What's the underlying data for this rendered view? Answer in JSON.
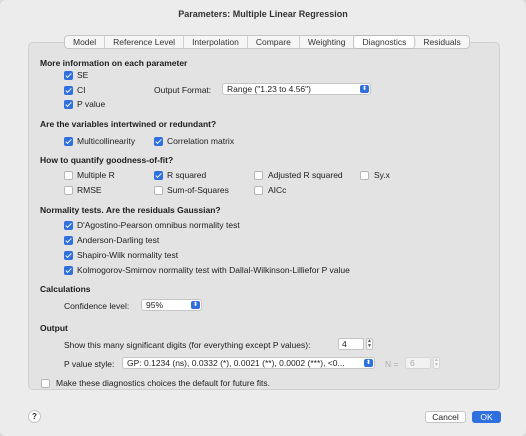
{
  "window": {
    "title": "Parameters: Multiple Linear Regression"
  },
  "tabs": [
    "Model",
    "Reference Level",
    "Interpolation",
    "Compare",
    "Weighting",
    "Diagnostics",
    "Residuals"
  ],
  "active_tab": "Diagnostics",
  "sections": {
    "more_info": {
      "header": "More information on each parameter",
      "se": "SE",
      "ci": "CI",
      "p_value": "P value",
      "output_format_label": "Output Format:",
      "output_format_value": "Range (\"1.23 to 4.56\")"
    },
    "redundant": {
      "header": "Are the variables intertwined or redundant?",
      "multicollinearity": "Multicollinearity",
      "correlation_matrix": "Correlation matrix"
    },
    "goodness": {
      "header": "How to quantify goodness-of-fit?",
      "multiple_r": "Multiple R",
      "r_squared": "R squared",
      "adj_r_squared": "Adjusted R squared",
      "syx": "Sy.x",
      "rmse": "RMSE",
      "sum_of_squares": "Sum-of-Squares",
      "aicc": "AICc"
    },
    "normality": {
      "header": "Normality tests. Are the residuals Gaussian?",
      "dagostino": "D'Agostino-Pearson omnibus normality test",
      "anderson": "Anderson-Darling test",
      "shapiro": "Shapiro-Wilk normality test",
      "kolmogorov": "Kolmogorov-Smirnov normality test with Dallal-Wilkinson-Lilliefor P value"
    },
    "calculations": {
      "header": "Calculations",
      "confidence_label": "Confidence level:",
      "confidence_value": "95%"
    },
    "output": {
      "header": "Output",
      "sig_digits_label": "Show this many significant digits (for everything except P values):",
      "sig_digits_value": "4",
      "p_style_label": "P value style:",
      "p_style_value": "GP: 0.1234 (ns), 0.0332 (*), 0.0021 (**), 0.0002 (***), <0...",
      "n_label": "N =",
      "n_value": "6"
    }
  },
  "default_checkbox": "Make these diagnostics choices the default for future fits.",
  "buttons": {
    "help": "?",
    "cancel": "Cancel",
    "ok": "OK"
  },
  "colors": {
    "accent": "#2f6fde",
    "panel": "#e3e3e3",
    "window": "#ececec"
  }
}
